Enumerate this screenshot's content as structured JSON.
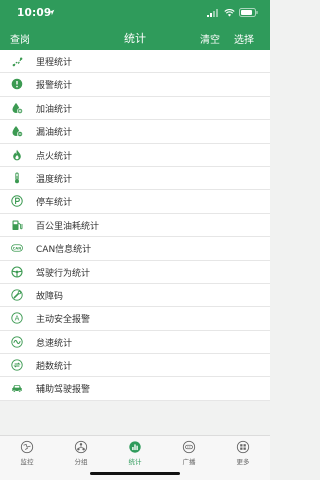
{
  "status": {
    "time": "10:09"
  },
  "nav": {
    "left": "查岗",
    "title": "统计",
    "right1": "清空",
    "right2": "选择"
  },
  "items": [
    {
      "label": "里程统计",
      "icon": "mileage-icon"
    },
    {
      "label": "报警统计",
      "icon": "alarm-icon"
    },
    {
      "label": "加油统计",
      "icon": "refuel-icon"
    },
    {
      "label": "漏油统计",
      "icon": "oil-leak-icon"
    },
    {
      "label": "点火统计",
      "icon": "ignition-icon"
    },
    {
      "label": "温度统计",
      "icon": "temperature-icon"
    },
    {
      "label": "停车统计",
      "icon": "parking-icon"
    },
    {
      "label": "百公里油耗统计",
      "icon": "fuel-consumption-icon"
    },
    {
      "label": "CAN信息统计",
      "icon": "can-icon"
    },
    {
      "label": "驾驶行为统计",
      "icon": "steering-wheel-icon"
    },
    {
      "label": "故障码",
      "icon": "fault-code-icon"
    },
    {
      "label": "主动安全报警",
      "icon": "active-safety-icon"
    },
    {
      "label": "怠速统计",
      "icon": "idle-icon"
    },
    {
      "label": "趟数统计",
      "icon": "trips-icon"
    },
    {
      "label": "辅助驾驶报警",
      "icon": "driver-assist-icon"
    }
  ],
  "tabs": [
    {
      "label": "监控",
      "icon": "monitor-icon"
    },
    {
      "label": "分组",
      "icon": "group-icon"
    },
    {
      "label": "统计",
      "icon": "statistics-icon",
      "active": true
    },
    {
      "label": "广播",
      "icon": "broadcast-icon"
    },
    {
      "label": "更多",
      "icon": "more-icon"
    }
  ],
  "colors": {
    "brand": "#2f9b5b",
    "icon": "#3c9a52",
    "tab_inactive": "#666666"
  }
}
